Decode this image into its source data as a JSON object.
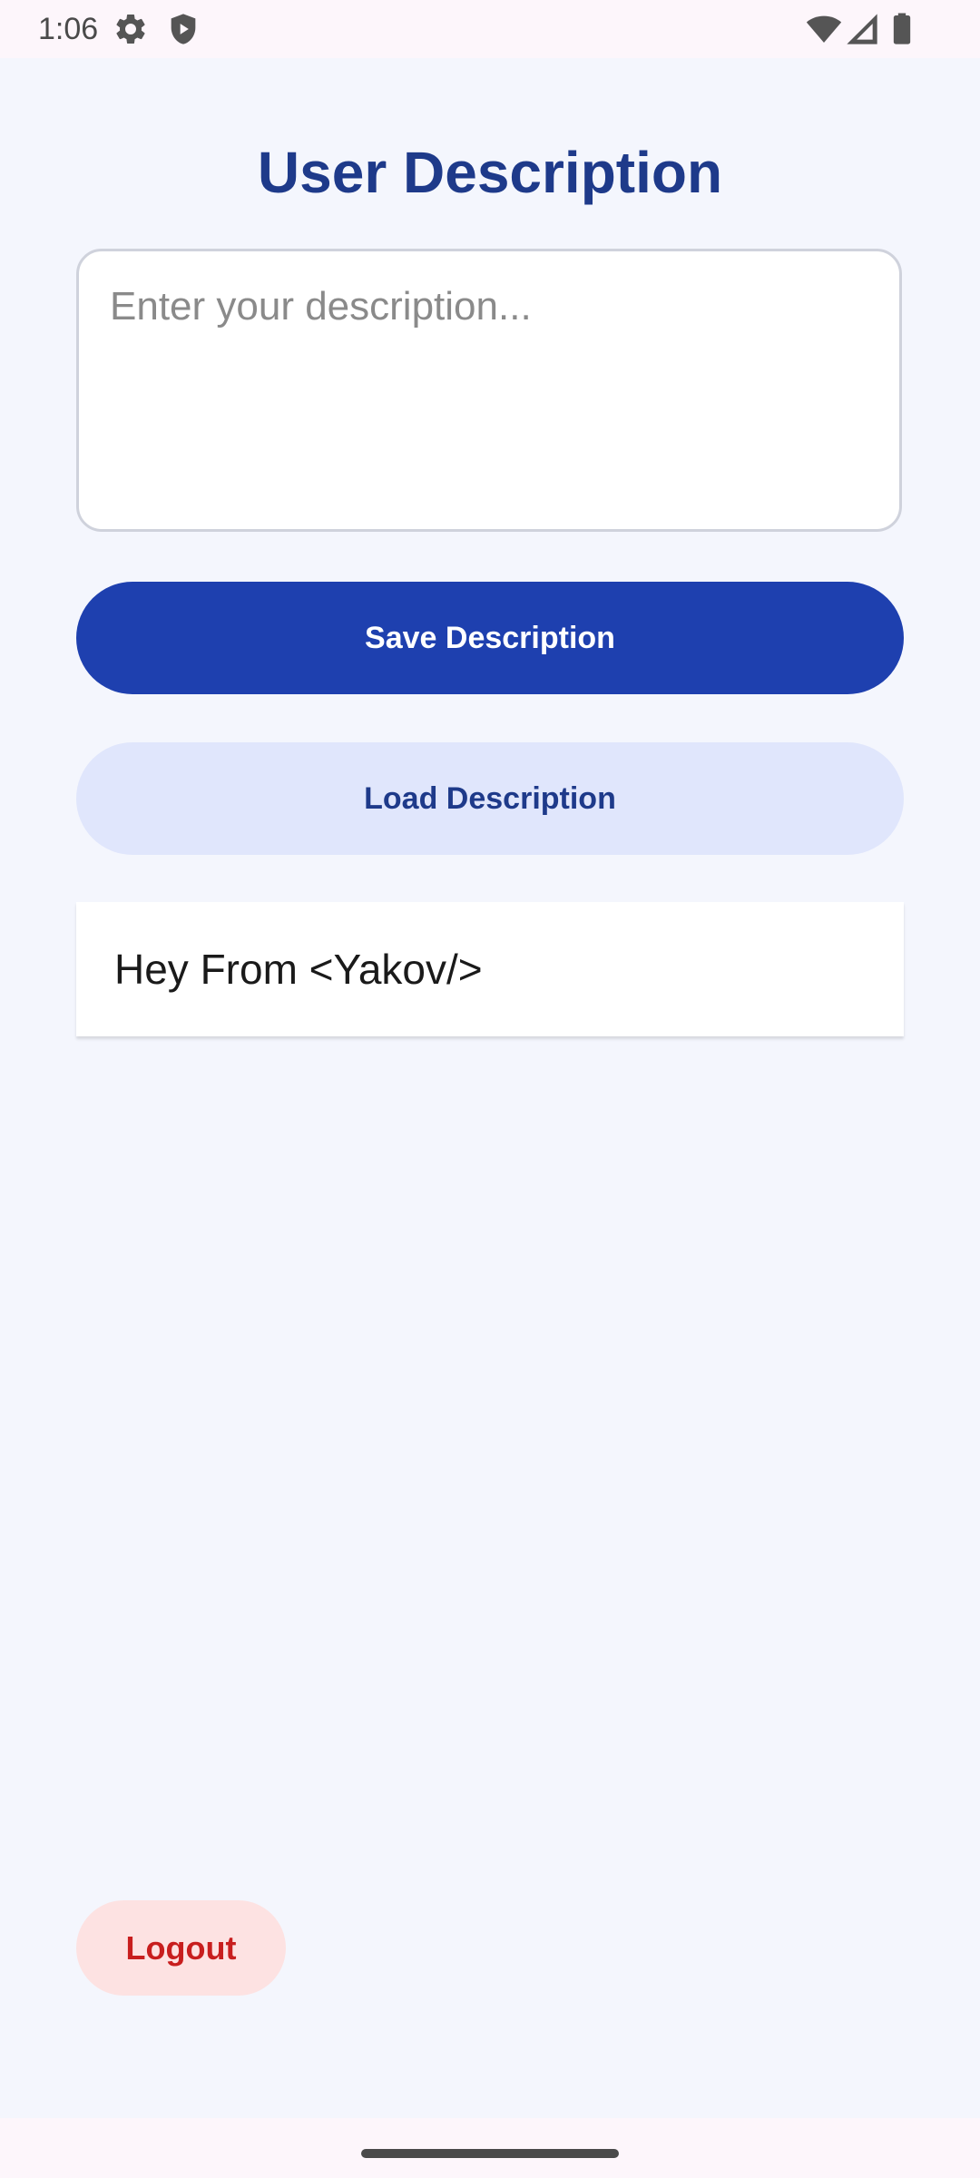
{
  "status_bar": {
    "time": "1:06",
    "icons": [
      "gear-icon",
      "shield-icon",
      "wifi-icon",
      "signal-icon",
      "battery-icon"
    ]
  },
  "page": {
    "title": "User Description"
  },
  "description_input": {
    "placeholder": "Enter your description...",
    "value": ""
  },
  "buttons": {
    "save_label": "Save Description",
    "load_label": "Load Description",
    "logout_label": "Logout"
  },
  "result": {
    "text": "Hey From <Yakov/>"
  },
  "colors": {
    "title": "#1e3a8a",
    "primary": "#1e40af",
    "secondary_bg": "#e0e6fc",
    "logout_bg": "#fde2e2",
    "logout_text": "#c81e1e",
    "background": "#f4f6fd"
  }
}
